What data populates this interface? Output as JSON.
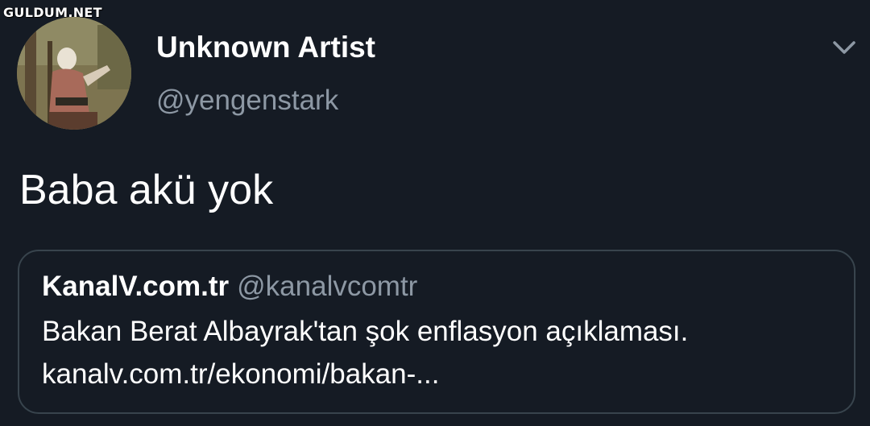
{
  "watermark": "GULDUM.NET",
  "tweet": {
    "author": {
      "display_name": "Unknown Artist",
      "handle": "@yengenstark"
    },
    "text": "Baba akü yok",
    "menu_icon": "chevron-down-icon"
  },
  "quote": {
    "display_name": "KanalV.com.tr",
    "handle": "@kanalvcomtr",
    "text": "Bakan Berat Albayrak'tan şok enflasyon açıklaması.",
    "link": "kanalv.com.tr/ekonomi/bakan-..."
  },
  "colors": {
    "background": "#151b24",
    "primary_text": "#ffffff",
    "secondary_text": "#8d98a4",
    "card_border": "#38444d"
  }
}
